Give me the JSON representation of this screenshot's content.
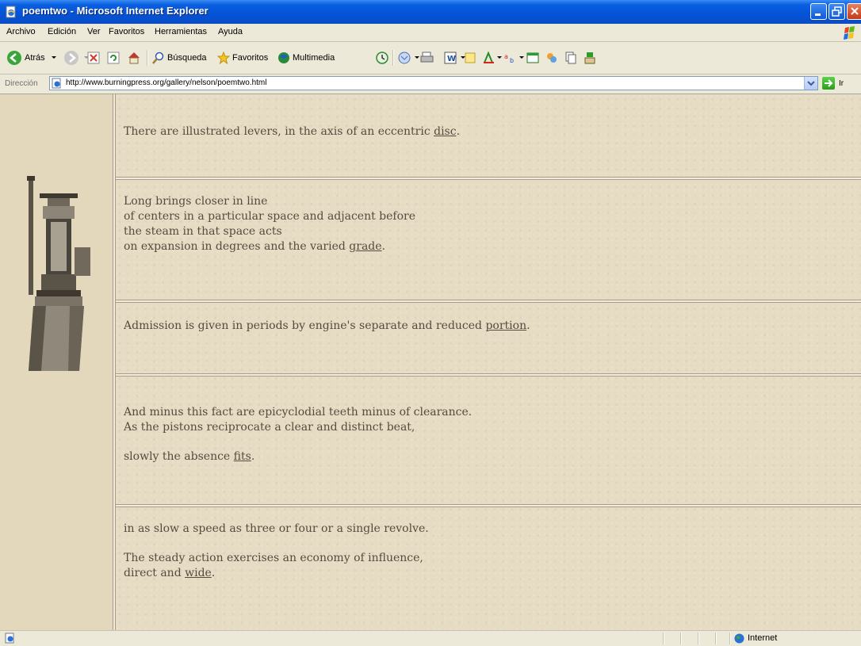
{
  "window": {
    "title": "poemtwo - Microsoft Internet Explorer"
  },
  "menu": {
    "items": [
      "Archivo",
      "Edición",
      "Ver",
      "Favoritos",
      "Herramientas",
      "Ayuda"
    ]
  },
  "toolbar": {
    "back_label": "Atrás",
    "search_label": "Búsqueda",
    "favorites_label": "Favoritos",
    "media_label": "Multimedia"
  },
  "address": {
    "label": "Dirección",
    "url": "http://www.burningpress.org/gallery/nelson/poemtwo.html",
    "go_label": "Ir"
  },
  "poem": {
    "stanza1": {
      "text": "There are illustrated levers, in the axis of an eccentric ",
      "link": "disc",
      "end": "."
    },
    "stanza2": {
      "lines": [
        "Long brings closer in line",
        "of centers in a particular space and adjacent before",
        "the steam in that space acts"
      ],
      "last_text": "on expansion in degrees and the varied ",
      "link": "grade",
      "end": "."
    },
    "stanza3": {
      "text": "Admission is given in periods by engine's separate and reduced ",
      "link": "portion",
      "end": "."
    },
    "stanza4": {
      "lines": [
        "And minus this fact are epicyclodial teeth minus of clearance.",
        "As the pistons reciprocate a clear and distinct beat,"
      ],
      "last_text": "slowly the absence ",
      "link": "fits",
      "end": "."
    },
    "stanza5": {
      "line1": "in as slow a speed as three or four or a single revolve.",
      "line2": "The steady action exercises an economy of influence,",
      "last_text": "direct and ",
      "link": "wide",
      "end": "."
    }
  },
  "status": {
    "zone": "Internet"
  },
  "colors": {
    "titlebar": "#0453d6",
    "page_background": "#e6dcc4",
    "poem_text": "#564b3e"
  }
}
